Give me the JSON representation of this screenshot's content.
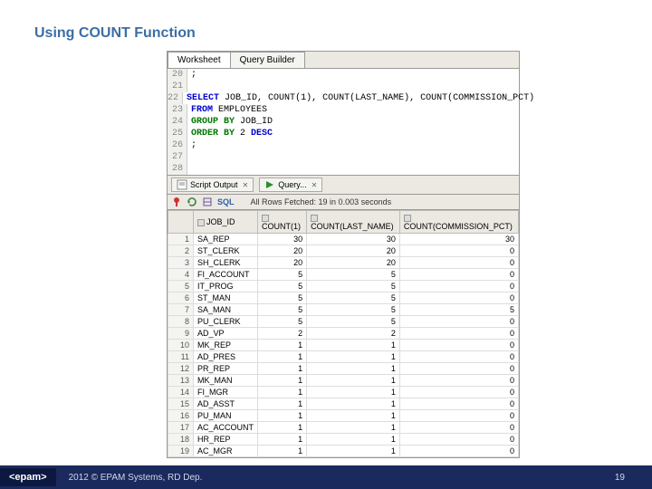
{
  "slide": {
    "title": "Using COUNT Function"
  },
  "tabs": {
    "worksheet": "Worksheet",
    "querybuilder": "Query Builder"
  },
  "code": {
    "lines": [
      {
        "n": 20,
        "t": ";"
      },
      {
        "n": 21,
        "t": ""
      },
      {
        "n": 22,
        "html": "<span class='kw'>SELECT</span> JOB_ID, <span class='fn'>COUNT</span>(1), <span class='fn'>COUNT</span>(LAST_NAME), <span class='fn'>COUNT</span>(COMMISSION_PCT)"
      },
      {
        "n": 23,
        "html": "<span class='kw'>FROM</span> EMPLOYEES"
      },
      {
        "n": 24,
        "html": "<span class='gr'>GROUP BY</span> JOB_ID"
      },
      {
        "n": 25,
        "html": "<span class='gr'>ORDER BY</span> 2 <span class='kw'>DESC</span>"
      },
      {
        "n": 26,
        "t": ";"
      },
      {
        "n": 27,
        "t": ""
      },
      {
        "n": 28,
        "t": ""
      }
    ]
  },
  "outputTabs": {
    "script": "Script Output",
    "query": "Query..."
  },
  "toolbar": {
    "sql": "SQL",
    "status": "All Rows Fetched: 19 in 0.003 seconds"
  },
  "grid": {
    "cols": [
      "JOB_ID",
      "COUNT(1)",
      "COUNT(LAST_NAME)",
      "COUNT(COMMISSION_PCT)"
    ],
    "rows": [
      [
        "SA_REP",
        30,
        30,
        30
      ],
      [
        "ST_CLERK",
        20,
        20,
        0
      ],
      [
        "SH_CLERK",
        20,
        20,
        0
      ],
      [
        "FI_ACCOUNT",
        5,
        5,
        0
      ],
      [
        "IT_PROG",
        5,
        5,
        0
      ],
      [
        "ST_MAN",
        5,
        5,
        0
      ],
      [
        "SA_MAN",
        5,
        5,
        5
      ],
      [
        "PU_CLERK",
        5,
        5,
        0
      ],
      [
        "AD_VP",
        2,
        2,
        0
      ],
      [
        "MK_REP",
        1,
        1,
        0
      ],
      [
        "AD_PRES",
        1,
        1,
        0
      ],
      [
        "PR_REP",
        1,
        1,
        0
      ],
      [
        "MK_MAN",
        1,
        1,
        0
      ],
      [
        "FI_MGR",
        1,
        1,
        0
      ],
      [
        "AD_ASST",
        1,
        1,
        0
      ],
      [
        "PU_MAN",
        1,
        1,
        0
      ],
      [
        "AC_ACCOUNT",
        1,
        1,
        0
      ],
      [
        "HR_REP",
        1,
        1,
        0
      ],
      [
        "AC_MGR",
        1,
        1,
        0
      ]
    ]
  },
  "footer": {
    "logo": "<epam>",
    "copy": "2012 © EPAM Systems, RD Dep.",
    "page": "19"
  }
}
